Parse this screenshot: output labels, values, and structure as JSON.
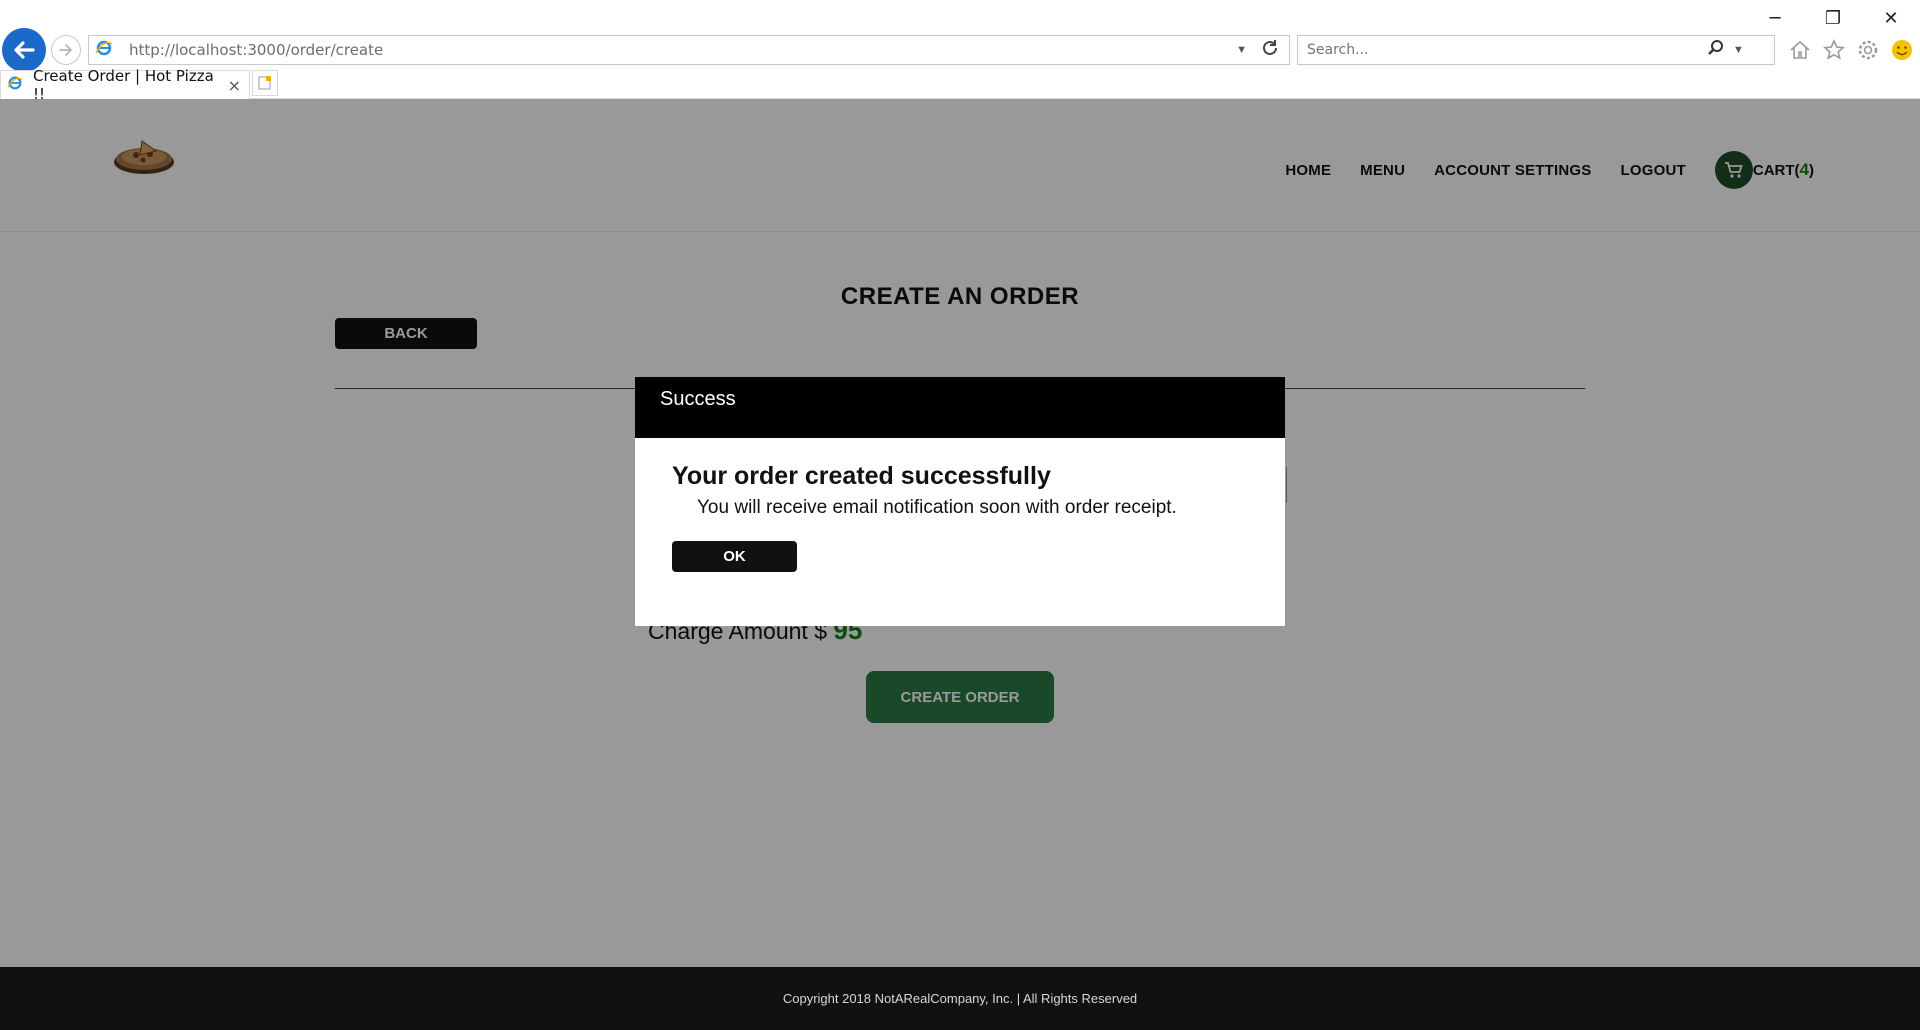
{
  "browser": {
    "url": "http://localhost:3000/order/create",
    "search_placeholder": "Search...",
    "tab_title": "Create Order | Hot Pizza !!",
    "tab_close": "×",
    "window_controls": [
      "─",
      "❐",
      "✕"
    ],
    "accent_color": "#1b6ac9"
  },
  "header": {
    "nav": {
      "home": "HOME",
      "menu": "MENU",
      "account_settings": "ACCOUNT SETTINGS",
      "logout": "LOGOUT",
      "cart_label": "CART(",
      "cart_count": "4",
      "cart_close": ")"
    },
    "cart_icon_color": "#1e4d2b"
  },
  "main": {
    "title": "CREATE AN ORDER",
    "back_label": "BACK",
    "charge_label": "Charge Amount $ ",
    "charge_amount": "95",
    "create_order_label": "CREATE ORDER"
  },
  "modal": {
    "header": "Success",
    "heading": "Your order created successfully",
    "message": "You will receive email notification soon with order receipt.",
    "ok_label": "OK"
  },
  "footer": {
    "copyright": "Copyright 2018 NotARealCompany, Inc. | All Rights Reserved"
  },
  "colors": {
    "overlay": "rgba(0,0,0,0.4)",
    "success_green": "#2a7a45",
    "amount_green": "#1a7a1a"
  }
}
